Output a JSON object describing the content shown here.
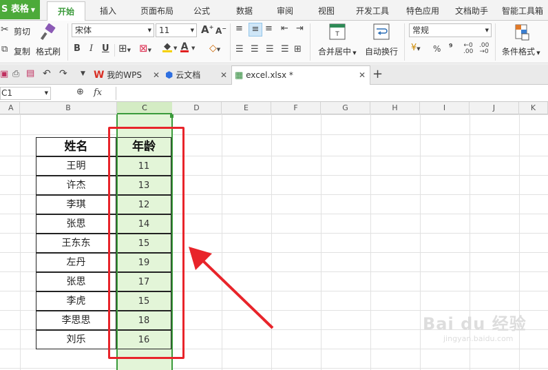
{
  "app": {
    "name": "S 表格"
  },
  "menu_tabs": [
    "开始",
    "插入",
    "页面布局",
    "公式",
    "数据",
    "审阅",
    "视图",
    "开发工具",
    "特色应用",
    "文档助手",
    "智能工具箱"
  ],
  "ribbon": {
    "cut": "剪切",
    "copy": "复制",
    "format_painter": "格式刷",
    "font_name": "宋体",
    "font_size": "11",
    "bold": "B",
    "italic": "I",
    "underline": "U",
    "grow": "A",
    "shrink": "A",
    "merge_center": "合并居中",
    "wrap": "自动换行",
    "number_format": "常规",
    "percent": "%",
    "thousands": "⁹",
    "cond_format": "条件格式"
  },
  "doc_tabs": [
    {
      "label": "我的WPS",
      "icon": "wps-logo-icon"
    },
    {
      "label": "云文档",
      "icon": "cloud-doc-icon"
    },
    {
      "label": "excel.xlsx *",
      "icon": "sheet-file-icon"
    }
  ],
  "add_tab": "+",
  "formula_bar": {
    "name_box": "C1",
    "fx": "fx"
  },
  "columns": [
    "A",
    "B",
    "C",
    "D",
    "E",
    "F",
    "G",
    "H",
    "I",
    "J",
    "K"
  ],
  "table": {
    "headers": [
      "姓名",
      "年龄"
    ],
    "rows": [
      [
        "王明",
        "11"
      ],
      [
        "许杰",
        "13"
      ],
      [
        "李琪",
        "12"
      ],
      [
        "张思",
        "14"
      ],
      [
        "王东东",
        "15"
      ],
      [
        "左丹",
        "19"
      ],
      [
        "张思",
        "17"
      ],
      [
        "李虎",
        "15"
      ],
      [
        "李思思",
        "18"
      ],
      [
        "刘乐",
        "16"
      ]
    ]
  },
  "watermark": {
    "text": "Bai du 经验",
    "sub": "jingyan.baidu.com"
  },
  "colors": {
    "accent": "#3a9a3a",
    "selection_fill": "#e3f5d8",
    "highlight": "#e8242a",
    "app_badge": "#4caa3a"
  }
}
